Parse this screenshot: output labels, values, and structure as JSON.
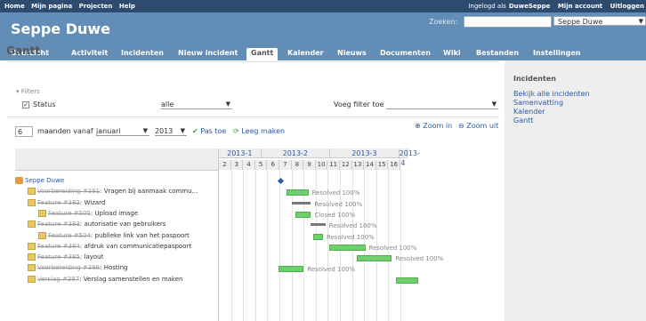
{
  "topbar": {
    "menu": [
      "Home",
      "Mijn pagina",
      "Projecten",
      "Help"
    ],
    "logged_in_text": "Ingelogd als",
    "user": "DuweSeppe",
    "account": "Mijn account",
    "logout": "Uitloggen"
  },
  "header": {
    "title": "Seppe Duwe",
    "search_label": "Zoeken:",
    "search_value": "",
    "project_select": "Seppe Duwe"
  },
  "mainmenu": [
    "Overzicht",
    "Activiteit",
    "Incidenten",
    "Nieuw incident",
    "Gantt",
    "Kalender",
    "Nieuws",
    "Documenten",
    "Wiki",
    "Bestanden",
    "Instellingen"
  ],
  "mainmenu_selected": "Gantt",
  "page": {
    "title": "Gantt",
    "filters_label": "Filters",
    "status_label": "Status",
    "status_value": "alle",
    "add_filter_label": "Voeg filter toe",
    "months_value": "6",
    "months_label": "maanden vanaf",
    "month_value": "januari",
    "year_value": "2013",
    "apply": "Pas toe",
    "clear": "Leeg maken",
    "zoom_in": "Zoom in",
    "zoom_out": "Zoom uit"
  },
  "sidebar": {
    "heading": "Incidenten",
    "links": [
      "Bekijk alle incidenten",
      "Samenvatting",
      "Kalender",
      "Gantt"
    ]
  },
  "gantt": {
    "quarters": [
      "2013-1",
      "2013-2",
      "2013-3",
      "2013-4"
    ],
    "weeks": [
      "2",
      "3",
      "4",
      "5",
      "6",
      "7",
      "8",
      "9",
      "10",
      "11",
      "12",
      "13",
      "14",
      "15",
      "16"
    ],
    "rows": [
      {
        "id": "",
        "subject": "Seppe Duwe",
        "type": "project",
        "indent": 0
      },
      {
        "id": "Voorbereiding #381",
        "subject": "Vragen bij aanmaak commu...",
        "type": "issue",
        "indent": 1,
        "status": "Resolved 100%"
      },
      {
        "id": "Feature #382",
        "subject": "Wizard",
        "type": "issue",
        "indent": 1,
        "status": "Resolved 100%"
      },
      {
        "id": "Feature #505",
        "subject": "Upload image",
        "type": "issue",
        "indent": 2,
        "status": "Closed 100%"
      },
      {
        "id": "Feature #383",
        "subject": "autorisatie van gebruikers",
        "type": "issue",
        "indent": 1,
        "status": "Resolved 100%"
      },
      {
        "id": "Feature #504",
        "subject": "publieke link van het paspoort",
        "type": "issue",
        "indent": 2,
        "status": "Resolved 100%"
      },
      {
        "id": "Feature #384",
        "subject": "afdruk van communicatiepaspoort",
        "type": "issue",
        "indent": 1,
        "status": "Resolved 100%"
      },
      {
        "id": "Feature #385",
        "subject": "layout",
        "type": "issue",
        "indent": 1,
        "status": "Resolved 100%"
      },
      {
        "id": "Voorbereiding #386",
        "subject": "Hosting",
        "type": "issue",
        "indent": 1,
        "status": "Resolved 100%"
      },
      {
        "id": "Verslag #387",
        "subject": "Verslag samenstellen en maken",
        "type": "issue",
        "indent": 1,
        "status": ""
      }
    ]
  },
  "colors": {
    "header": "#628db6",
    "topbar": "#2c4b6e",
    "bar": "#6fcf6f",
    "link": "#2a5aa8"
  }
}
